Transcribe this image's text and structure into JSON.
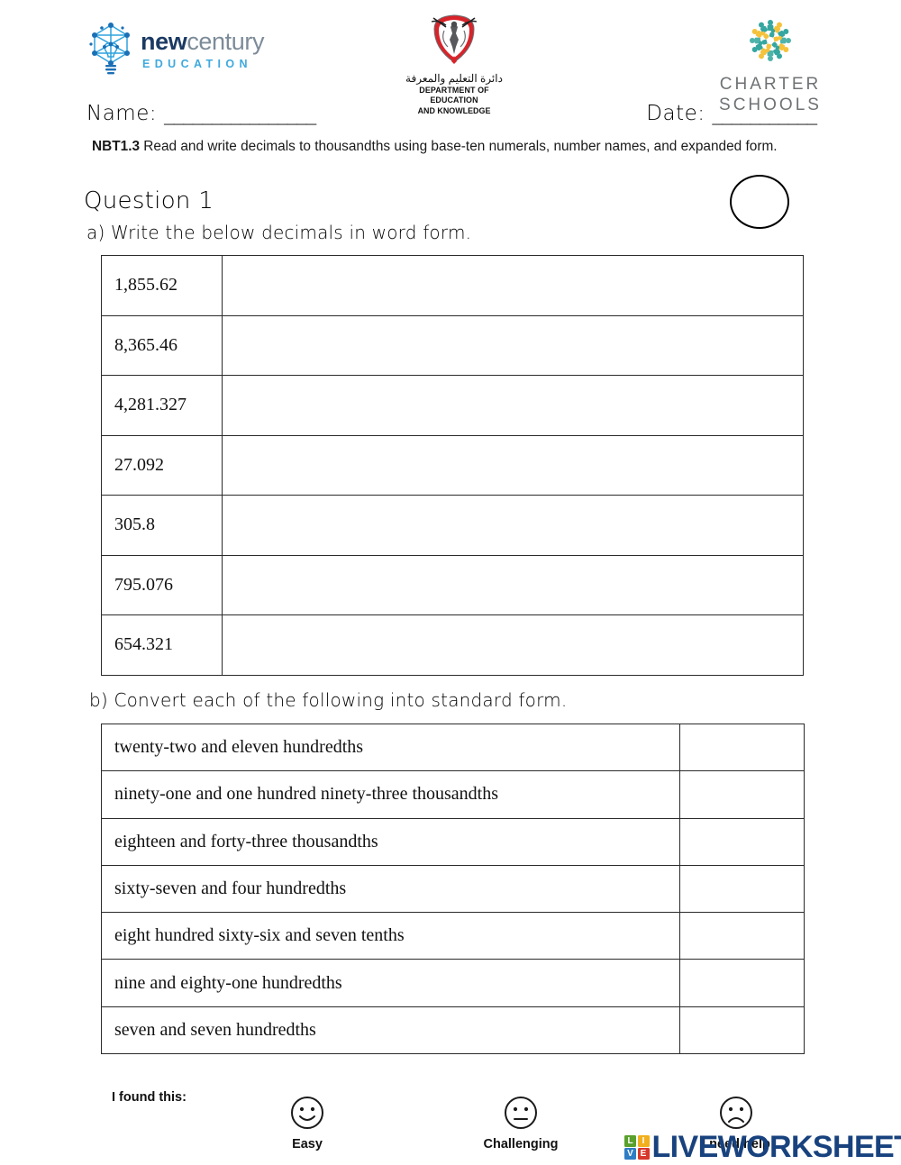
{
  "header": {
    "logos": {
      "newcentury": {
        "icon": "lightbulb-network-icon",
        "word1": "new",
        "word2": "century",
        "tagline": "EDUCATION",
        "color_dark": "#1b3a63",
        "color_light": "#7c8b99",
        "color_accent": "#3fa9dd"
      },
      "doek": {
        "icon": "abu-dhabi-falcon-emblem-icon",
        "arabic": "دائرة التعليم والمعرفة",
        "english_line1": "DEPARTMENT OF EDUCATION",
        "english_line2": "AND KNOWLEDGE",
        "color_red": "#d8232a"
      },
      "charter": {
        "icon": "people-circle-icon",
        "line1": "CHARTER",
        "line2": "SCHOOLS",
        "color_teal": "#35a6a0",
        "color_yellow": "#f5c23b",
        "color_text": "#6f7274"
      }
    },
    "name_label": "Name:",
    "name_line": "________________",
    "date_label": "Date:",
    "date_line": "___________"
  },
  "standard": {
    "code": "NBT1.3",
    "text": " Read and write decimals to thousandths using base-ten numerals, number names, and expanded form."
  },
  "question": {
    "title": "Question 1",
    "part_a_prompt": "a) Write the below decimals in word form.",
    "part_b_prompt": "b) Convert each of the following into standard form.",
    "score_bubble": ""
  },
  "table_a": {
    "rows": [
      {
        "number": "1,855.62",
        "answer": ""
      },
      {
        "number": "8,365.46",
        "answer": ""
      },
      {
        "number": "4,281.327",
        "answer": ""
      },
      {
        "number": "27.092",
        "answer": ""
      },
      {
        "number": "305.8",
        "answer": ""
      },
      {
        "number": "795.076",
        "answer": ""
      },
      {
        "number": "654.321",
        "answer": ""
      }
    ]
  },
  "table_b": {
    "rows": [
      {
        "words": "twenty-two and eleven hundredths",
        "answer": ""
      },
      {
        "words": "ninety-one and one hundred ninety-three thousandths",
        "answer": ""
      },
      {
        "words": "eighteen and forty-three thousandths",
        "answer": ""
      },
      {
        "words": "sixty-seven and four hundredths",
        "answer": ""
      },
      {
        "words": "eight hundred sixty-six and seven tenths",
        "answer": ""
      },
      {
        "words": "nine and eighty-one hundredths",
        "answer": ""
      },
      {
        "words": "seven and seven hundredths",
        "answer": ""
      }
    ]
  },
  "footer": {
    "found_label": "I found this:",
    "faces": [
      {
        "icon": "smiley-happy-icon",
        "label": "Easy"
      },
      {
        "icon": "smiley-neutral-icon",
        "label": "Challenging"
      },
      {
        "icon": "smiley-sad-icon",
        "label": "I need help"
      }
    ]
  },
  "watermark": {
    "squares": [
      {
        "letter": "L",
        "color": "#5aa02c"
      },
      {
        "letter": "I",
        "color": "#f2b01e"
      },
      {
        "letter": "V",
        "color": "#2f7dc4"
      },
      {
        "letter": "E",
        "color": "#d8372b"
      }
    ],
    "text": "LIVEWORKSHEETS",
    "text_color": "#18427e"
  }
}
